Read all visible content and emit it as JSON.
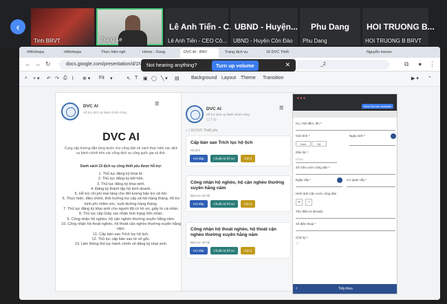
{
  "meet": {
    "tiles": [
      {
        "name": "Tinh BRVT"
      },
      {
        "name": "Trung Le"
      },
      {
        "big": "Lê Anh Tiến - C...",
        "name": "Lê Anh Tiến - CEO Cô..."
      },
      {
        "big": "UBND - Huyện...",
        "name": "UBND - Huyện Côn Đảo"
      },
      {
        "big": "Phu Dang",
        "name": "Phu Dang"
      },
      {
        "big": "HOI TRUONG B...",
        "name": "HOI TRUONG B BRVT"
      }
    ]
  },
  "browser": {
    "tabs": [
      "rtWorkspa",
      "rtWorkspa",
      "Thực hiện ngh",
      "Home - Goog",
      "DVC AI - BRV",
      "Trang dịch vụ",
      "16 DVC Thiết",
      "Nguyễn messe"
    ],
    "url": "docs.google.com/presentation/d/1NFaWvp0qCwhu",
    "url_tail": "_2"
  },
  "toast": {
    "text": "Not hearing anything?",
    "button": "Turn up volume",
    "close": "✕"
  },
  "toolbar": {
    "fit": "Fit",
    "background": "Background",
    "layout": "Layout",
    "theme": "Theme",
    "transition": "Transition"
  },
  "slide1": {
    "brand": "DVC AI",
    "sub": "Hỗ trợ dịch vụ hành chính công",
    "title": "DVC AI",
    "intro": "Cung cấp hướng dẫn từng bước cho công dân về cách thực hiện các dịch vụ hành chính trên các cổng dịch vụ công quốc gia và tỉnh.",
    "list_heading": "Danh sách 15 dịch vụ công thiết yếu được hỗ trợ:",
    "items": [
      "1. Thủ tục đăng ký khai tử.",
      "2. Thủ tục đăng ký kết hôn.",
      "3. Thủ tục đăng ký khai sinh.",
      "4. Đăng ký thành lập hộ kinh doanh.",
      "5. Hỗ trợ chi phí mai táng cho đối tượng bảo trợ xã hội.",
      "6. Thực hiện, điều chỉnh, thôi hưởng trợ cấp xã hội hàng tháng, hỗ trợ kinh phí chăm sóc, nuôi dưỡng hàng tháng.",
      "7. Thủ tục đăng ký khai sinh cho người đã có hồ sơ, giấy tờ cá nhân.",
      "8. Thủ tục cấp Giấy xác nhận tình trạng hôn nhân.",
      "9. Công nhận hộ nghèo, hộ cận nghèo thường xuyên hằng năm.",
      "10. Công nhận hộ thoát nghèo, hộ thoát cận nghèo thường xuyên hằng năm.",
      "11. Cấp bản sao Trích lục hộ tịch.",
      "12. Thủ tục cấp bản sao từ sổ gốc.",
      "13. Liên thông thủ tục hành chính về đăng ký khai sinh."
    ]
  },
  "slide2": {
    "brand": "DVC AI",
    "sub": "Hỗ trợ dịch vụ hành chính công",
    "breadcrumb": "⌂ / 16 DVC Thiết yếu",
    "cards": [
      {
        "title": "Cấp bản sao Trích lục hộ tịch",
        "meta": "Hộ tịch"
      },
      {
        "title": "Công nhận hộ nghèo, hộ cận nghèo thường xuyên hằng năm",
        "meta": "Bảo trợ xã hội"
      },
      {
        "title": "Công nhận hộ thoát nghèo, hộ thoát cận nghèo thường xuyên hằng năm",
        "meta": "Bảo trợ xã hội"
      }
    ],
    "btn_ask": "Hỏi đáp",
    "btn_prep": "Chuẩn bị hồ sơ",
    "btn_submit": "Gửi ý"
  },
  "phone": {
    "chip": "New Chrome available",
    "fullname": "Họ, chữ đệm, tên *",
    "gender": "Giới tính *",
    "male": "Nam",
    "female": "Nữ",
    "dob": "Ngày sinh *",
    "ethnic": "Dân tộc *",
    "ethnic_val": "Chọn",
    "idcard": "Số Căn cước công dân *",
    "issue_date": "Ngày cấp *",
    "issue_place": "Cơ quan cấp *",
    "photo": "Hình ảnh Căn cước công dân",
    "email": "Thư điện tử (Email)",
    "phone_no": "Số điện thoại *",
    "sign": "Chữ ký *",
    "next": "Tiếp theo"
  },
  "colors": {
    "meet_bg": "#202124",
    "accent": "#3b7ced",
    "blue_btn": "#2d5fb3",
    "teal_btn": "#2b7d78",
    "gold_btn": "#c29a1c"
  }
}
